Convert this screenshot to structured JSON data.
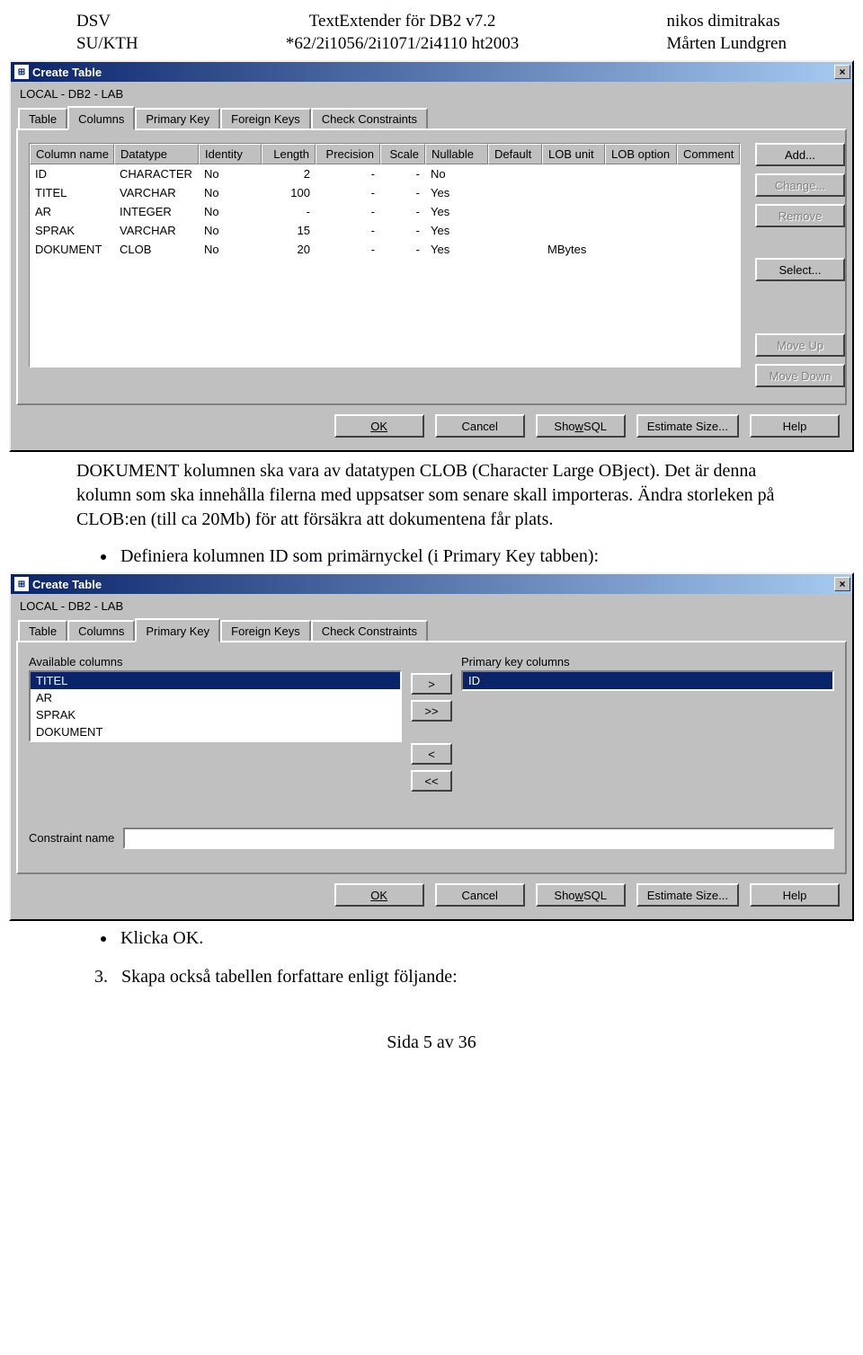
{
  "header": {
    "left1": "DSV",
    "left2": "SU/KTH",
    "center1": "TextExtender för DB2 v7.2",
    "center2": "*62/2i1056/2i1071/2i4110 ht2003",
    "right1": "nikos dimitrakas",
    "right2": "Mårten Lundgren"
  },
  "dialog1": {
    "title": "Create Table",
    "breadcrumb": "LOCAL - DB2 - LAB",
    "tabs": [
      "Table",
      "Columns",
      "Primary Key",
      "Foreign Keys",
      "Check Constraints"
    ],
    "active_tab": 1,
    "columns_headers": [
      "Column name",
      "Datatype",
      "Identity",
      "Length",
      "Precision",
      "Scale",
      "Nullable",
      "Default",
      "LOB unit",
      "LOB option",
      "Comment"
    ],
    "rows": [
      {
        "name": "ID",
        "datatype": "CHARACTER",
        "identity": "No",
        "length": "2",
        "precision": "-",
        "scale": "-",
        "nullable": "No",
        "default": "",
        "lobunit": "",
        "lobopt": "",
        "comment": ""
      },
      {
        "name": "TITEL",
        "datatype": "VARCHAR",
        "identity": "No",
        "length": "100",
        "precision": "-",
        "scale": "-",
        "nullable": "Yes",
        "default": "",
        "lobunit": "",
        "lobopt": "",
        "comment": ""
      },
      {
        "name": "AR",
        "datatype": "INTEGER",
        "identity": "No",
        "length": "-",
        "precision": "-",
        "scale": "-",
        "nullable": "Yes",
        "default": "",
        "lobunit": "",
        "lobopt": "",
        "comment": ""
      },
      {
        "name": "SPRAK",
        "datatype": "VARCHAR",
        "identity": "No",
        "length": "15",
        "precision": "-",
        "scale": "-",
        "nullable": "Yes",
        "default": "",
        "lobunit": "",
        "lobopt": "",
        "comment": ""
      },
      {
        "name": "DOKUMENT",
        "datatype": "CLOB",
        "identity": "No",
        "length": "20",
        "precision": "-",
        "scale": "-",
        "nullable": "Yes",
        "default": "",
        "lobunit": "MBytes",
        "lobopt": "",
        "comment": ""
      }
    ],
    "side_buttons": {
      "add": "Add...",
      "change": "Change...",
      "remove": "Remove",
      "select": "Select...",
      "moveup": "Move Up",
      "movedown": "Move Down"
    },
    "bottom": {
      "ok": "OK",
      "cancel": "Cancel",
      "showsql": "Show SQL",
      "estimate": "Estimate Size...",
      "help": "Help"
    }
  },
  "para1": "DOKUMENT kolumnen ska vara av datatypen CLOB (Character Large OBject). Det är denna kolumn som ska innehålla filerna med uppsatser som senare skall importeras. Ändra storleken på CLOB:en (till ca 20Mb) för att försäkra att dokumentena får plats.",
  "bullet1": "Definiera kolumnen ID som primärnyckel (i Primary Key tabben):",
  "dialog2": {
    "title": "Create Table",
    "breadcrumb": "LOCAL - DB2 - LAB",
    "tabs": [
      "Table",
      "Columns",
      "Primary Key",
      "Foreign Keys",
      "Check Constraints"
    ],
    "active_tab": 2,
    "avail_label": "Available columns",
    "pk_label": "Primary key columns",
    "available": [
      "TITEL",
      "AR",
      "SPRAK",
      "DOKUMENT"
    ],
    "primary": [
      "ID"
    ],
    "transfer": {
      "r": ">",
      "rr": ">>",
      "l": "<",
      "ll": "<<"
    },
    "constraint_label": "Constraint name",
    "bottom": {
      "ok": "OK",
      "cancel": "Cancel",
      "showsql": "Show SQL",
      "estimate": "Estimate Size...",
      "help": "Help"
    }
  },
  "bullet2": "Klicka OK.",
  "bullet3_num": "3.",
  "bullet3_text": "Skapa också tabellen forfattare enligt följande:",
  "footer": "Sida 5 av 36"
}
